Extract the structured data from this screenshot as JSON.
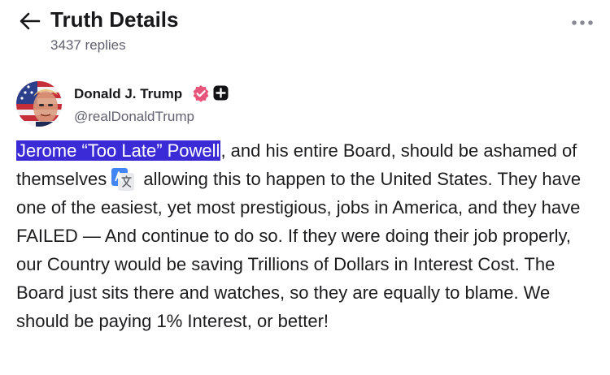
{
  "header": {
    "title": "Truth Details",
    "replies": "3437 replies",
    "back_icon": "arrow-left-icon",
    "more_icon": "ellipsis-horizontal-icon"
  },
  "author": {
    "name": "Donald J. Trump",
    "handle": "@realDonaldTrump",
    "verified_icon": "verified-badge-icon",
    "plus_icon": "plus-badge-icon",
    "verified_color": "#e8547a"
  },
  "post": {
    "highlighted_text": "Jerome “Too Late” Powell",
    "text_part1": ", and his entire Board, should be ashamed of themselves",
    "text_part2": " allowing this to happen to the United States. They have one of the easiest, yet most prestigious, jobs in America, and they have FAILED — And continue to do so. If they were doing their job properly, our Country would be saving Trillions of Dollars in Interest Cost. The Board just sits there and watches, so they are equally to blame. We should be paying 1% Interest, or better!",
    "highlight_color": "#3b2bd6",
    "translate_icon": "google-translate-icon"
  }
}
